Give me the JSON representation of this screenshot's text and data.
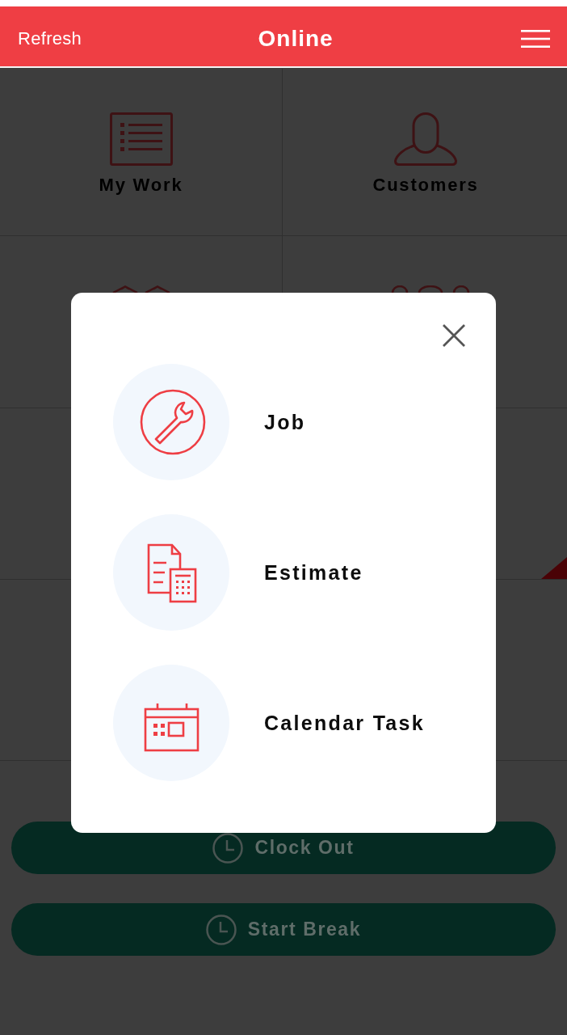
{
  "header": {
    "left_action": "Refresh",
    "title": "Online"
  },
  "tiles": [
    {
      "label": "My Work",
      "kind": "list",
      "flagged": false
    },
    {
      "label": "Customers",
      "kind": "person",
      "flagged": false
    },
    {
      "kind": "roofs",
      "flagged": false
    },
    {
      "kind": "people",
      "flagged": false
    },
    {
      "flagged": false
    },
    {
      "flagged": true
    },
    {
      "flagged": false
    },
    {
      "flagged": false
    }
  ],
  "buttons": [
    {
      "label": "Clock Out"
    },
    {
      "label": "Start Break"
    }
  ],
  "modal": {
    "options": [
      {
        "label": "Job",
        "kind": "wrench"
      },
      {
        "label": "Estimate",
        "kind": "estimate"
      },
      {
        "label": "Calendar Task",
        "kind": "calendar"
      }
    ]
  }
}
